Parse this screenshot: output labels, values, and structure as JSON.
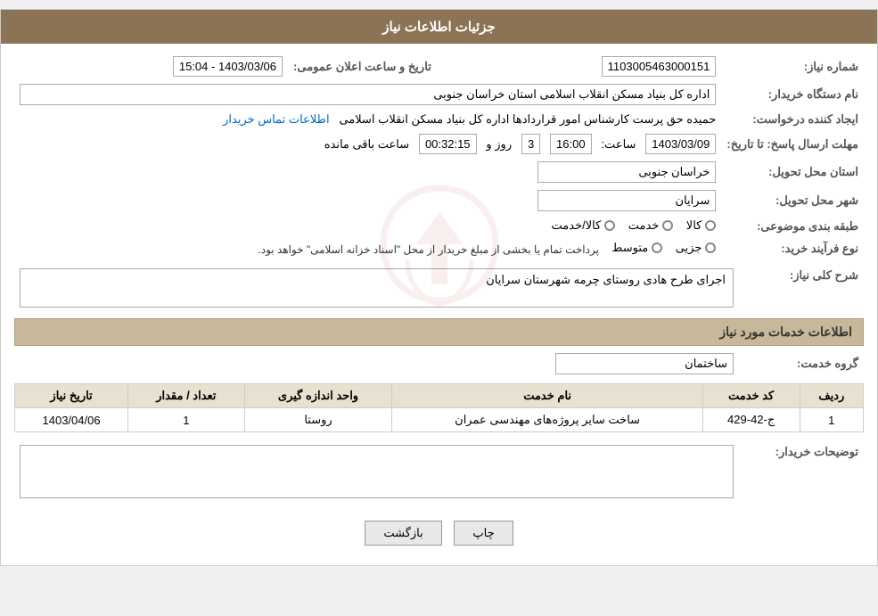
{
  "page": {
    "title": "جزئیات اطلاعات نیاز"
  },
  "header": {
    "title": "جزئیات اطلاعات نیاز"
  },
  "fields": {
    "need_number_label": "شماره نیاز:",
    "need_number_value": "1103005463000151",
    "announce_label": "تاریخ و ساعت اعلان عمومی:",
    "announce_value": "1403/03/06 - 15:04",
    "buyer_org_label": "نام دستگاه خریدار:",
    "buyer_org_value": "اداره کل بنیاد مسکن انقلاب اسلامی استان خراسان جنوبی",
    "creator_label": "ایجاد کننده درخواست:",
    "creator_value": "حمیده حق پرست کارشناس امور قراردادها اداره کل بنیاد مسکن انقلاب اسلامی",
    "contact_link": "اطلاعات تماس خریدار",
    "deadline_label": "مهلت ارسال پاسخ: تا تاریخ:",
    "deadline_date": "1403/03/09",
    "deadline_time_label": "ساعت:",
    "deadline_time": "16:00",
    "deadline_days_label": "روز و",
    "deadline_days": "3",
    "deadline_remaining_label": "ساعت باقی مانده",
    "deadline_remaining": "00:32:15",
    "province_label": "استان محل تحویل:",
    "province_value": "خراسان جنوبی",
    "city_label": "شهر محل تحویل:",
    "city_value": "سرایان",
    "category_label": "طبقه بندی موضوعی:",
    "category_options": [
      "کالا",
      "خدمت",
      "کالا/خدمت"
    ],
    "category_selected": "کالا",
    "purchase_label": "نوع فرآیند خرید:",
    "purchase_options": [
      "جزیی",
      "متوسط"
    ],
    "purchase_note": "پرداخت تمام یا بخشی از مبلغ خریدار از محل \"اسناد خزانه اسلامی\" خواهد بود.",
    "description_label": "شرح کلی نیاز:",
    "description_value": "اجرای طرح هادی روستای چرمه شهرستان سرایان",
    "services_section_title": "اطلاعات خدمات مورد نیاز",
    "service_group_label": "گروه خدمت:",
    "service_group_value": "ساختمان",
    "table_headers": [
      "ردیف",
      "کد خدمت",
      "نام خدمت",
      "واحد اندازه گیری",
      "تعداد / مقدار",
      "تاریخ نیاز"
    ],
    "table_rows": [
      {
        "row": "1",
        "service_code": "ج-42-429",
        "service_name": "ساخت سایر پروژه‌های مهندسی عمران",
        "unit": "روستا",
        "quantity": "1",
        "date": "1403/04/06"
      }
    ],
    "buyer_desc_label": "توضیحات خریدار:",
    "buyer_desc_value": ""
  },
  "buttons": {
    "print": "چاپ",
    "back": "بازگشت"
  }
}
